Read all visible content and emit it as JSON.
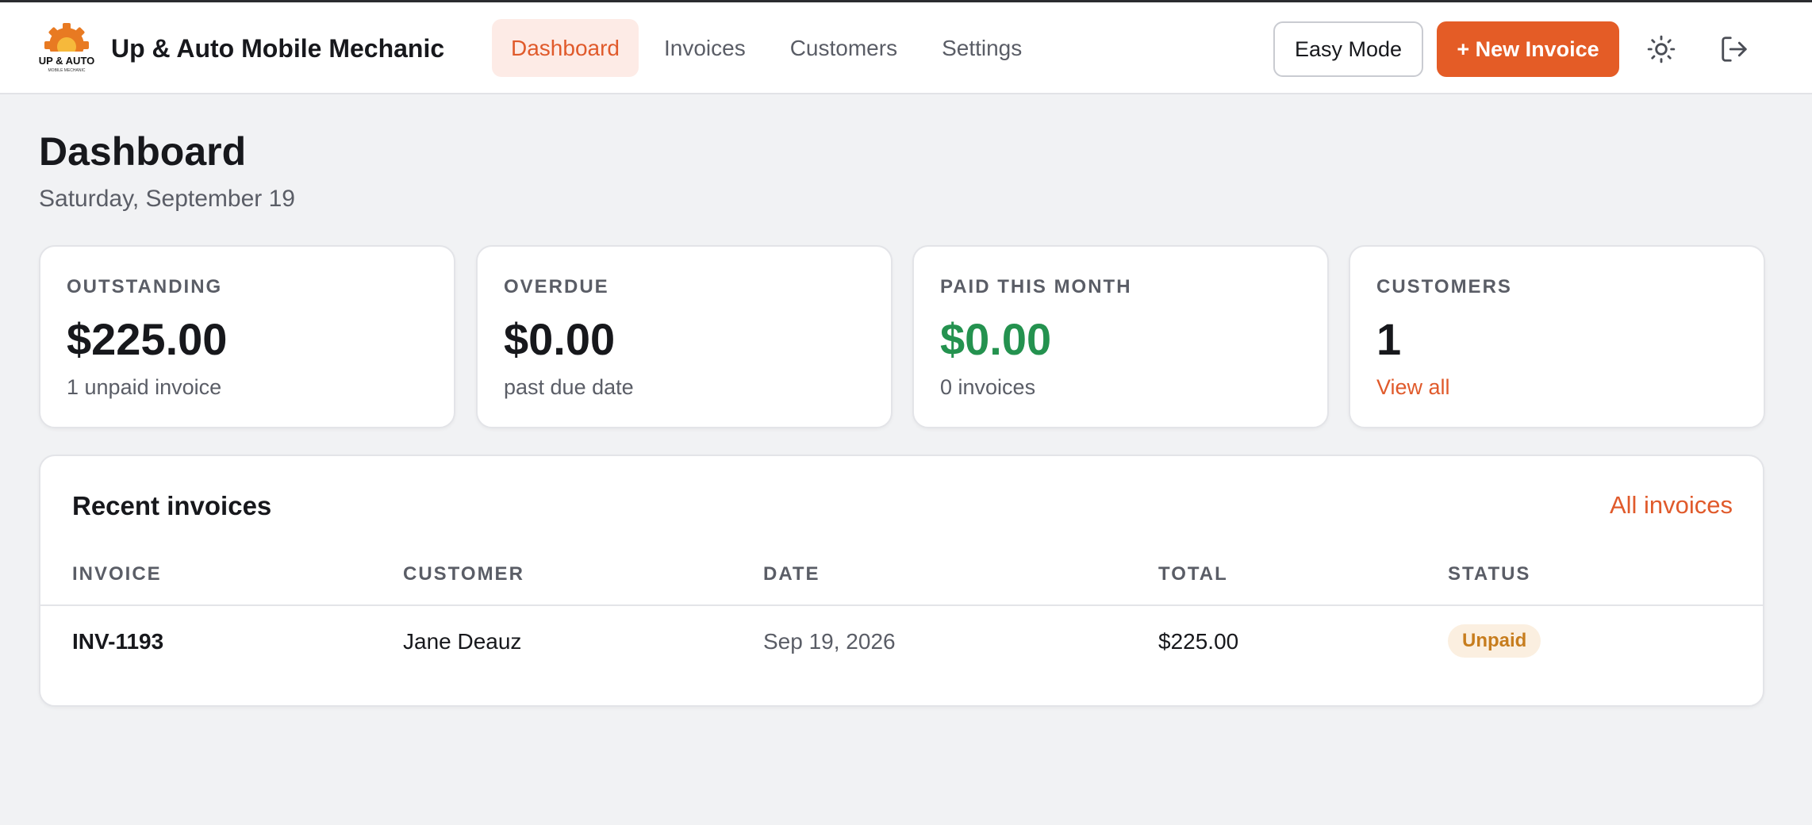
{
  "app": {
    "name": "Up & Auto Mobile Mechanic",
    "logo_text_main": "UP & AUTO",
    "logo_text_sub": "MOBILE MECHANIC"
  },
  "nav": {
    "items": [
      {
        "label": "Dashboard",
        "active": true
      },
      {
        "label": "Invoices",
        "active": false
      },
      {
        "label": "Customers",
        "active": false
      },
      {
        "label": "Settings",
        "active": false
      }
    ]
  },
  "toolbar": {
    "easy_mode_label": "Easy Mode",
    "new_invoice_label": "+ New Invoice",
    "theme_icon": "sun-icon",
    "logout_icon": "logout-icon"
  },
  "page": {
    "title": "Dashboard",
    "date": "Saturday, September 19"
  },
  "stats": [
    {
      "label": "OUTSTANDING",
      "value": "$225.00",
      "sub": "1 unpaid invoice"
    },
    {
      "label": "OVERDUE",
      "value": "$0.00",
      "sub": "past due date"
    },
    {
      "label": "PAID THIS MONTH",
      "value": "$0.00",
      "sub": "0 invoices"
    },
    {
      "label": "CUSTOMERS",
      "value": "1",
      "link": "View all"
    }
  ],
  "recent": {
    "title": "Recent invoices",
    "all_link": "All invoices",
    "columns": [
      "INVOICE",
      "CUSTOMER",
      "DATE",
      "TOTAL",
      "STATUS"
    ],
    "rows": [
      {
        "invoice": "INV-1193",
        "customer": "Jane Deauz",
        "date": "Sep 19, 2026",
        "total": "$225.00",
        "status": "Unpaid"
      }
    ]
  },
  "colors": {
    "accent": "#e45c26",
    "accent_text": "#e05a2b",
    "nav_active_bg": "#fdebe6",
    "paid_green": "#24924f",
    "unpaid_badge_bg": "#fbefe0",
    "unpaid_badge_text": "#c77d1e",
    "page_bg": "#f1f2f4"
  }
}
